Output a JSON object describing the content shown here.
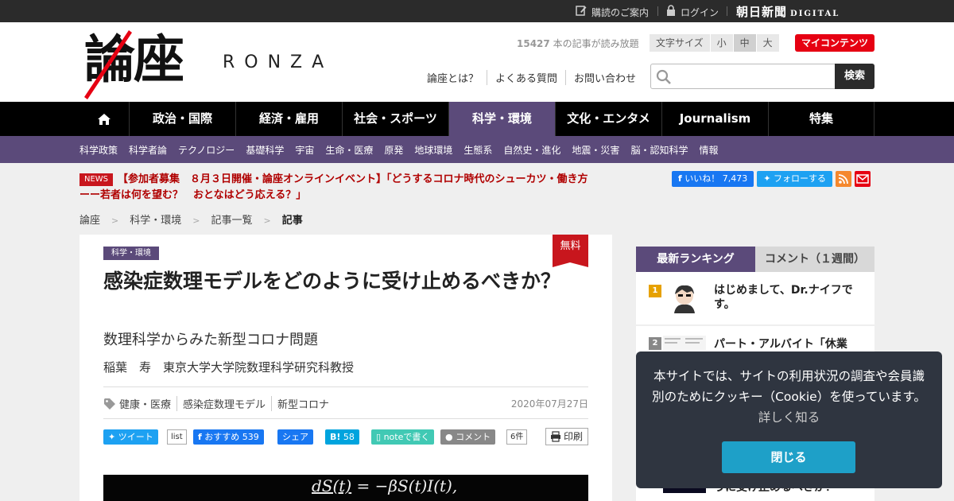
{
  "topbar": {
    "subscribe": "購読のご案内",
    "login": "ログイン",
    "asahi": "朝日新聞",
    "digital": "DIGITAL"
  },
  "header": {
    "logo_kanji": "論座",
    "logo_latin": "RONZA",
    "read_count": "15427",
    "read_count_suffix": " 本の記事が読み放題",
    "font_size_label": "文字サイズ",
    "font_sizes": [
      "小",
      "中",
      "大"
    ],
    "font_size_selected": "中",
    "my_content": "マイコンテンツ",
    "links": [
      "論座とは？",
      "よくある質問",
      "お問い合わせ"
    ],
    "search_placeholder": "",
    "search_button": "検索"
  },
  "nav": {
    "items": [
      "政治・国際",
      "経済・雇用",
      "社会・スポーツ",
      "科学・環境",
      "文化・エンタメ",
      "Journalism",
      "特集"
    ],
    "active": "科学・環境"
  },
  "subnav": {
    "items": [
      "科学政策",
      "科学者論",
      "テクノロジー",
      "基礎科学",
      "宇宙",
      "生命・医療",
      "原発",
      "地球環境",
      "生態系",
      "自然史・進化",
      "地震・災害",
      "脳・認知科学",
      "情報"
    ]
  },
  "news": {
    "badge": "NEWS",
    "text": "【参加者募集　８月３日開催・論座オンラインイベント】「どうするコロナ時代のシューカツ・働き方ーー若者は何を望む？　おとなはどう応える？」"
  },
  "social": {
    "fb_like": "いいね！",
    "fb_count": "7,473",
    "twitter_follow": "フォローする"
  },
  "breadcrumb": [
    "論座",
    "科学・環境",
    "記事一覧",
    "記事"
  ],
  "article": {
    "category": "科学・環境",
    "free": "無料",
    "title": "感染症数理モデルをどのように受け止めるべきか？",
    "subtitle": "数理科学からみた新型コロナ問題",
    "author": "稲葉　寿　東京大学大学院数理科学研究科教授",
    "tags": [
      "健康・医療",
      "感染症数理モデル",
      "新型コロナ"
    ],
    "date": "2020年07月27日",
    "share": {
      "tweet": "ツイート",
      "list": "list",
      "fb_recommend": "おすすめ",
      "fb_count": "539",
      "fb_share": "シェア",
      "hatena_count": "58",
      "note": "noteで書く",
      "comment": "コメント",
      "comment_count": "6件",
      "print": "印刷"
    },
    "equation_lhs": "dS(t)",
    "equation_rhs": "= −βS(t)I(t),"
  },
  "sidebar": {
    "tabs": [
      "最新ランキング",
      "コメント（１週間）"
    ],
    "ranking": [
      {
        "rank": "1",
        "title": "はじめまして、Dr.ナイフです。"
      },
      {
        "rank": "2",
        "title": "パート・アルバイト「休業"
      }
    ],
    "partial_title": "うに受け止めるべきか？"
  },
  "cookie": {
    "message": "本サイトでは、サイトの利用状況の調査や会員識別のためにクッキー（Cookie）を使っています。",
    "more": "詳しく知る",
    "close": "閉じる"
  },
  "colors": {
    "accent": "#5b4a7a",
    "red": "#c8161d",
    "nav_bg": "#000000"
  }
}
